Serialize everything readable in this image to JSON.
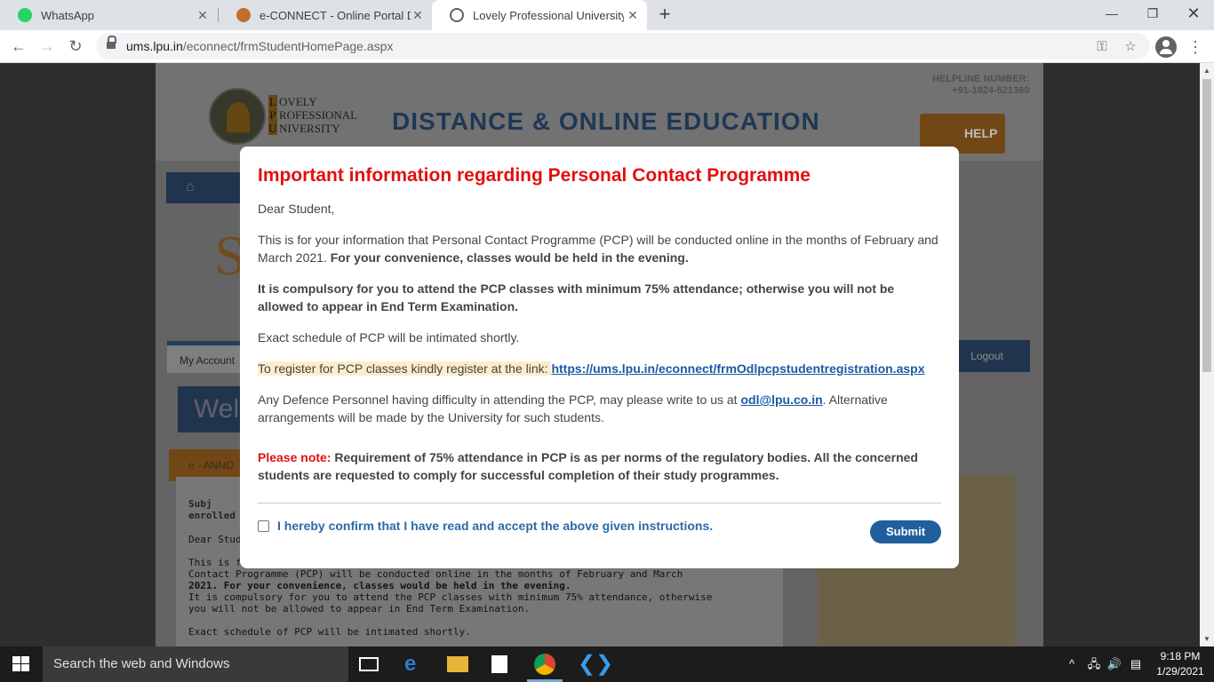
{
  "browser": {
    "tabs": [
      {
        "title": "WhatsApp",
        "icon": "whatsapp-icon",
        "active": false
      },
      {
        "title": "e-CONNECT - Online Portal Dista",
        "icon": "lpu-favicon-icon",
        "active": false
      },
      {
        "title": "Lovely Professional University - D",
        "icon": "globe-icon",
        "active": true
      }
    ],
    "url_host": "ums.lpu.in",
    "url_path": "/econnect/frmStudentHomePage.aspx"
  },
  "site": {
    "logo_lines": [
      {
        "cap": "L",
        "rest": "OVELY"
      },
      {
        "cap": "P",
        "rest": "ROFESSIONAL"
      },
      {
        "cap": "U",
        "rest": "NIVERSITY"
      }
    ],
    "banner": "DISTANCE & ONLINE EDUCATION",
    "helpline_label": "HELPLINE NUMBER:",
    "helpline_number": "+91-1824-521360",
    "help_label": "HELP",
    "account_label": "My Account",
    "logout_label": "Logout",
    "welcome_text": "Wel",
    "announce_label": "e - ANNO",
    "notice_lines": [
      "Subj",
      "enrolled i",
      "Dear Stud",
      "This is for",
      "Contact Programme (PCP) will be conducted online in the months of February and March",
      "2021. For your convenience, classes would be held in the evening.",
      "It is compulsory for you to attend the PCP classes with minimum 75% attendance, otherwise",
      "you will not be allowed to appear in End Term Examination.",
      "Exact schedule of PCP will be intimated shortly."
    ]
  },
  "modal": {
    "title": "Important information regarding Personal Contact Programme",
    "greeting": "Dear Student,",
    "p1_text": "This is for your information that Personal Contact Programme (PCP) will be conducted online in the months of February and March 2021. ",
    "p1_bold": "For your convenience, classes would be held in the evening.",
    "p2_bold": "It is compulsory for you to attend the PCP classes with minimum 75% attendance; otherwise you will not be allowed to appear in End Term Examination.",
    "p3": "Exact schedule of PCP will be intimated shortly.",
    "p4_text": "To register for PCP classes kindly register at the link: ",
    "p4_link": "https://ums.lpu.in/econnect/frmOdlpcpstudentregistration.aspx",
    "p5_text": "Any Defence Personnel having difficulty in attending the PCP, may please write to us at ",
    "p5_email": "odl@lpu.co.in",
    "p5_rest": ". Alternative arrangements will be made by the University for such students.",
    "note_label": "Please note:",
    "note_text": " Requirement of 75% attendance in PCP is as per norms of the regulatory bodies. All the concerned students are requested to comply for successful completion of their study programmes.",
    "confirm_label": "I hereby confirm that I have read and accept the above given instructions.",
    "confirm_checked": false,
    "submit_label": "Submit"
  },
  "taskbar": {
    "search_placeholder": "Search the web and Windows",
    "time": "9:18 PM",
    "date": "1/29/2021"
  },
  "colors": {
    "title_red": "#e21010",
    "link_blue": "#1b5aa6",
    "submit_blue": "#1f5f9e"
  }
}
